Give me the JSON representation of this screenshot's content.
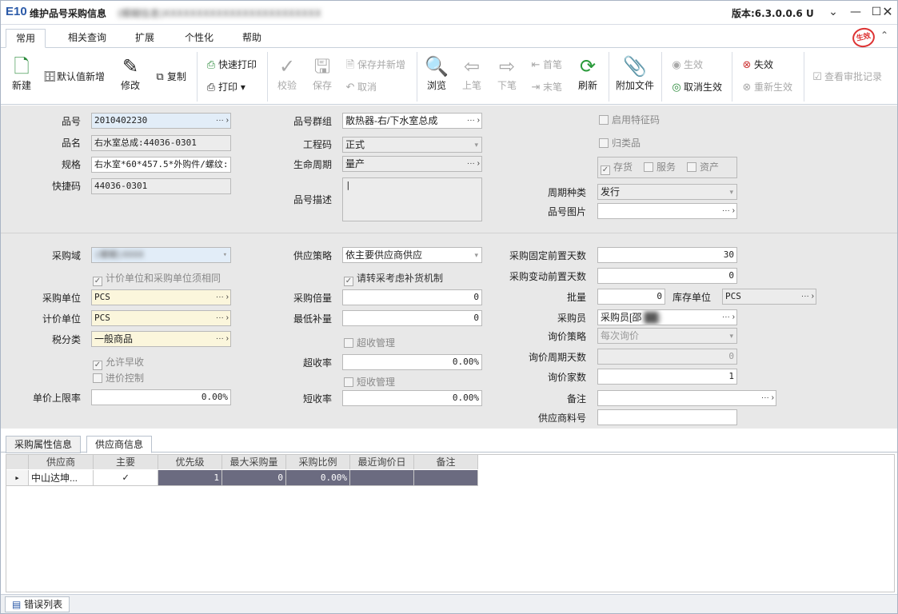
{
  "window": {
    "logo": "E10",
    "title": "维护品号采购信息",
    "subtitle": "(模糊信息)XXXXXXXXXXXXXXXXXXXXXXXX",
    "version": "版本:6.3.0.0.6 U"
  },
  "menu_tabs": [
    "常用",
    "相关查询",
    "扩展",
    "个性化",
    "帮助"
  ],
  "status_stamp": "生效",
  "toolbar": {
    "new": "新建",
    "default_new": "默认值新增",
    "edit": "修改",
    "copy": "复制",
    "quick_print": "快速打印",
    "print": "打印",
    "verify": "校验",
    "save": "保存",
    "save_new": "保存并新增",
    "cancel": "取消",
    "browse": "浏览",
    "prev": "上笔",
    "next": "下笔",
    "first": "首笔",
    "last": "末笔",
    "refresh": "刷新",
    "attach": "附加文件",
    "effective": "生效",
    "cancel_effective": "取消生效",
    "invalid": "失效",
    "re_effective": "重新生效",
    "view_approval": "查看审批记录"
  },
  "basic": {
    "item_no_label": "品号",
    "item_no": "2010402230",
    "item_name_label": "品名",
    "item_name": "右水室总成:44036-0301",
    "spec_label": "规格",
    "spec": "右水室*60*457.5*外购件/螺纹:",
    "shortcut_label": "快捷码",
    "shortcut": "44036-0301",
    "group_label": "品号群组",
    "group": "散热器-右/下水室总成",
    "eng_code_label": "工程码",
    "eng_code": "正式",
    "lifecycle_label": "生命周期",
    "lifecycle": "量产",
    "desc_label": "品号描述",
    "desc": "|",
    "feature_code": "启用特征码",
    "classified": "归类品",
    "inventory": "存货",
    "service": "服务",
    "asset": "资产",
    "cycle_type_label": "周期种类",
    "cycle_type": "发行",
    "image_label": "品号图片",
    "image": ""
  },
  "purchase": {
    "domain_label": "采购域",
    "domain": "(模糊)XXXX",
    "same_unit": "计价单位和采购单位须相同",
    "unit_label": "采购单位",
    "unit": "PCS",
    "price_unit_label": "计价单位",
    "price_unit": "PCS",
    "tax_label": "税分类",
    "tax": "一般商品",
    "allow_early": "允许早收",
    "price_control": "进价控制",
    "price_limit_label": "单价上限率",
    "price_limit": "0.00%",
    "strategy_label": "供应策略",
    "strategy": "依主要供应商供应",
    "replenish": "请转采考虑补货机制",
    "multiple_label": "采购倍量",
    "multiple": "0",
    "min_label": "最低补量",
    "min": "0",
    "over_mgmt": "超收管理",
    "over_rate_label": "超收率",
    "over_rate": "0.00%",
    "short_mgmt": "短收管理",
    "short_rate_label": "短收率",
    "short_rate": "0.00%",
    "fixed_lead_label": "采购固定前置天数",
    "fixed_lead": "30",
    "var_lead_label": "采购变动前置天数",
    "var_lead": "0",
    "batch_label": "批量",
    "batch": "0",
    "stock_unit_label": "库存单位",
    "stock_unit": "PCS",
    "buyer_label": "采购员",
    "buyer": "采购员[邵",
    "inquiry_strategy_label": "询价策略",
    "inquiry_strategy": "每次询价",
    "inquiry_days_label": "询价周期天数",
    "inquiry_days": "0",
    "inquiry_count_label": "询价家数",
    "inquiry_count": "1",
    "remark_label": "备注",
    "remark": "",
    "vendor_part_label": "供应商料号",
    "vendor_part": ""
  },
  "bottom_tabs": [
    "采购属性信息",
    "供应商信息"
  ],
  "grid": {
    "headers": [
      "供应商",
      "主要",
      "优先级",
      "最大采购量",
      "采购比例",
      "最近询价日",
      "备注"
    ],
    "rows": [
      {
        "vendor": "中山达坤...",
        "primary": "✓",
        "priority": "1",
        "max_qty": "0",
        "ratio": "0.00%",
        "last_inquiry": "",
        "remark": ""
      }
    ]
  },
  "error_list": "错误列表"
}
